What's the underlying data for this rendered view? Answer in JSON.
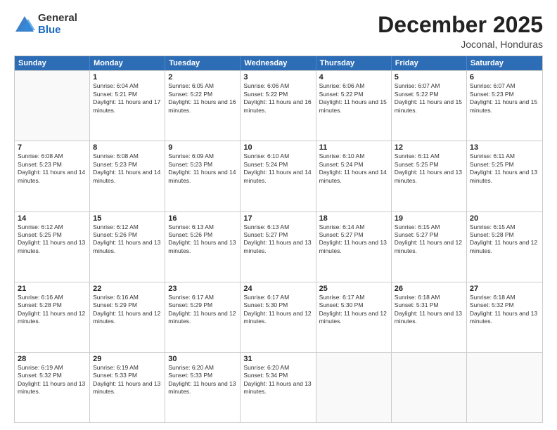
{
  "logo": {
    "general": "General",
    "blue": "Blue"
  },
  "title": "December 2025",
  "subtitle": "Joconal, Honduras",
  "header_days": [
    "Sunday",
    "Monday",
    "Tuesday",
    "Wednesday",
    "Thursday",
    "Friday",
    "Saturday"
  ],
  "weeks": [
    [
      {
        "day": "",
        "empty": true
      },
      {
        "day": "1",
        "sunrise": "6:04 AM",
        "sunset": "5:21 PM",
        "daylight": "11 hours and 17 minutes."
      },
      {
        "day": "2",
        "sunrise": "6:05 AM",
        "sunset": "5:22 PM",
        "daylight": "11 hours and 16 minutes."
      },
      {
        "day": "3",
        "sunrise": "6:06 AM",
        "sunset": "5:22 PM",
        "daylight": "11 hours and 16 minutes."
      },
      {
        "day": "4",
        "sunrise": "6:06 AM",
        "sunset": "5:22 PM",
        "daylight": "11 hours and 15 minutes."
      },
      {
        "day": "5",
        "sunrise": "6:07 AM",
        "sunset": "5:22 PM",
        "daylight": "11 hours and 15 minutes."
      },
      {
        "day": "6",
        "sunrise": "6:07 AM",
        "sunset": "5:23 PM",
        "daylight": "11 hours and 15 minutes."
      }
    ],
    [
      {
        "day": "7",
        "sunrise": "6:08 AM",
        "sunset": "5:23 PM",
        "daylight": "11 hours and 14 minutes."
      },
      {
        "day": "8",
        "sunrise": "6:08 AM",
        "sunset": "5:23 PM",
        "daylight": "11 hours and 14 minutes."
      },
      {
        "day": "9",
        "sunrise": "6:09 AM",
        "sunset": "5:23 PM",
        "daylight": "11 hours and 14 minutes."
      },
      {
        "day": "10",
        "sunrise": "6:10 AM",
        "sunset": "5:24 PM",
        "daylight": "11 hours and 14 minutes."
      },
      {
        "day": "11",
        "sunrise": "6:10 AM",
        "sunset": "5:24 PM",
        "daylight": "11 hours and 14 minutes."
      },
      {
        "day": "12",
        "sunrise": "6:11 AM",
        "sunset": "5:25 PM",
        "daylight": "11 hours and 13 minutes."
      },
      {
        "day": "13",
        "sunrise": "6:11 AM",
        "sunset": "5:25 PM",
        "daylight": "11 hours and 13 minutes."
      }
    ],
    [
      {
        "day": "14",
        "sunrise": "6:12 AM",
        "sunset": "5:25 PM",
        "daylight": "11 hours and 13 minutes."
      },
      {
        "day": "15",
        "sunrise": "6:12 AM",
        "sunset": "5:26 PM",
        "daylight": "11 hours and 13 minutes."
      },
      {
        "day": "16",
        "sunrise": "6:13 AM",
        "sunset": "5:26 PM",
        "daylight": "11 hours and 13 minutes."
      },
      {
        "day": "17",
        "sunrise": "6:13 AM",
        "sunset": "5:27 PM",
        "daylight": "11 hours and 13 minutes."
      },
      {
        "day": "18",
        "sunrise": "6:14 AM",
        "sunset": "5:27 PM",
        "daylight": "11 hours and 13 minutes."
      },
      {
        "day": "19",
        "sunrise": "6:15 AM",
        "sunset": "5:27 PM",
        "daylight": "11 hours and 12 minutes."
      },
      {
        "day": "20",
        "sunrise": "6:15 AM",
        "sunset": "5:28 PM",
        "daylight": "11 hours and 12 minutes."
      }
    ],
    [
      {
        "day": "21",
        "sunrise": "6:16 AM",
        "sunset": "5:28 PM",
        "daylight": "11 hours and 12 minutes."
      },
      {
        "day": "22",
        "sunrise": "6:16 AM",
        "sunset": "5:29 PM",
        "daylight": "11 hours and 12 minutes."
      },
      {
        "day": "23",
        "sunrise": "6:17 AM",
        "sunset": "5:29 PM",
        "daylight": "11 hours and 12 minutes."
      },
      {
        "day": "24",
        "sunrise": "6:17 AM",
        "sunset": "5:30 PM",
        "daylight": "11 hours and 12 minutes."
      },
      {
        "day": "25",
        "sunrise": "6:17 AM",
        "sunset": "5:30 PM",
        "daylight": "11 hours and 12 minutes."
      },
      {
        "day": "26",
        "sunrise": "6:18 AM",
        "sunset": "5:31 PM",
        "daylight": "11 hours and 13 minutes."
      },
      {
        "day": "27",
        "sunrise": "6:18 AM",
        "sunset": "5:32 PM",
        "daylight": "11 hours and 13 minutes."
      }
    ],
    [
      {
        "day": "28",
        "sunrise": "6:19 AM",
        "sunset": "5:32 PM",
        "daylight": "11 hours and 13 minutes."
      },
      {
        "day": "29",
        "sunrise": "6:19 AM",
        "sunset": "5:33 PM",
        "daylight": "11 hours and 13 minutes."
      },
      {
        "day": "30",
        "sunrise": "6:20 AM",
        "sunset": "5:33 PM",
        "daylight": "11 hours and 13 minutes."
      },
      {
        "day": "31",
        "sunrise": "6:20 AM",
        "sunset": "5:34 PM",
        "daylight": "11 hours and 13 minutes."
      },
      {
        "day": "",
        "empty": true
      },
      {
        "day": "",
        "empty": true
      },
      {
        "day": "",
        "empty": true
      }
    ]
  ]
}
